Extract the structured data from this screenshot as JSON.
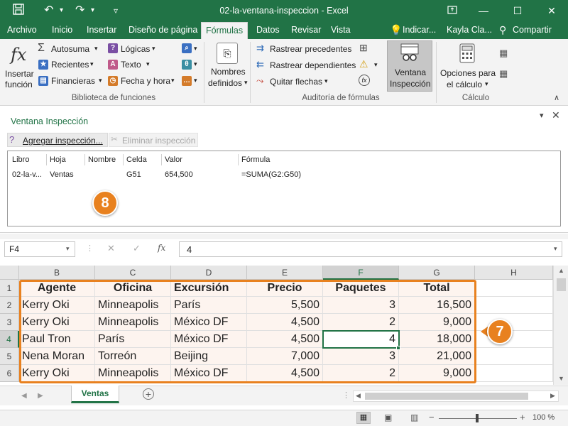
{
  "window": {
    "title": "02-la-ventana-inspeccion  -  Excel",
    "save_icon": "save-icon",
    "undo_icon": "undo-icon",
    "redo_icon": "redo-icon"
  },
  "tabs": {
    "archivo": "Archivo",
    "inicio": "Inicio",
    "insertar": "Insertar",
    "diseno": "Diseño de página",
    "formulas": "Fórmulas",
    "datos": "Datos",
    "revisar": "Revisar",
    "vista": "Vista",
    "tell_me": "Indicar...",
    "user": "Kayla Cla...",
    "share": "Compartir"
  },
  "ribbon": {
    "insert_function_1": "Insertar",
    "insert_function_2": "función",
    "autosum": "Autosuma",
    "recent": "Recientes",
    "financial": "Financieras",
    "logical": "Lógicas",
    "text": "Texto",
    "datetime": "Fecha y hora",
    "defined_names_1": "Nombres",
    "defined_names_2": "definidos",
    "trace_precedents": "Rastrear precedentes",
    "trace_dependents": "Rastrear dependientes",
    "remove_arrows": "Quitar flechas",
    "watch_window_1": "Ventana",
    "watch_window_2": "Inspección",
    "calc_options_1": "Opciones para",
    "calc_options_2": "el cálculo",
    "group_library": "Biblioteca de funciones",
    "group_audit": "Auditoría de fórmulas",
    "group_calc": "Cálculo"
  },
  "watch": {
    "title": "Ventana Inspección",
    "add": "Agregar inspección...",
    "delete": "Eliminar inspección",
    "columns": {
      "libro": "Libro",
      "hoja": "Hoja",
      "nombre": "Nombre",
      "celda": "Celda",
      "valor": "Valor",
      "formula": "Fórmula"
    },
    "row": {
      "libro": "02-la-v...",
      "hoja": "Ventas",
      "nombre": "",
      "celda": "G51",
      "valor": "654,500",
      "formula": "=SUMA(G2:G50)"
    }
  },
  "formula_bar": {
    "name_box": "F4",
    "fx": "fx",
    "value": "4"
  },
  "grid": {
    "col_headers": [
      "B",
      "C",
      "D",
      "E",
      "F",
      "G",
      "H"
    ],
    "row_headers": [
      "1",
      "2",
      "3",
      "4",
      "5",
      "6"
    ],
    "header_row": [
      "Agente",
      "Oficina",
      "Excursión",
      "Precio",
      "Paquetes",
      "Total"
    ],
    "rows": [
      [
        "Kerry Oki",
        "Minneapolis",
        "París",
        "5,500",
        "3",
        "16,500"
      ],
      [
        "Kerry Oki",
        "Minneapolis",
        "México DF",
        "4,500",
        "2",
        "9,000"
      ],
      [
        "Paul Tron",
        "París",
        "México DF",
        "4,500",
        "4",
        "18,000"
      ],
      [
        "Nena Moran",
        "Torreón",
        "Beijing",
        "7,000",
        "3",
        "21,000"
      ],
      [
        "Kerry Oki",
        "Minneapolis",
        "México DF",
        "4,500",
        "2",
        "9,000"
      ]
    ]
  },
  "sheet_tab": "Ventas",
  "zoom": "100 %",
  "callouts": {
    "badge_watch": "8",
    "badge_table": "7"
  },
  "colors": {
    "excel_green": "#217346",
    "callout_orange": "#e8811f"
  }
}
